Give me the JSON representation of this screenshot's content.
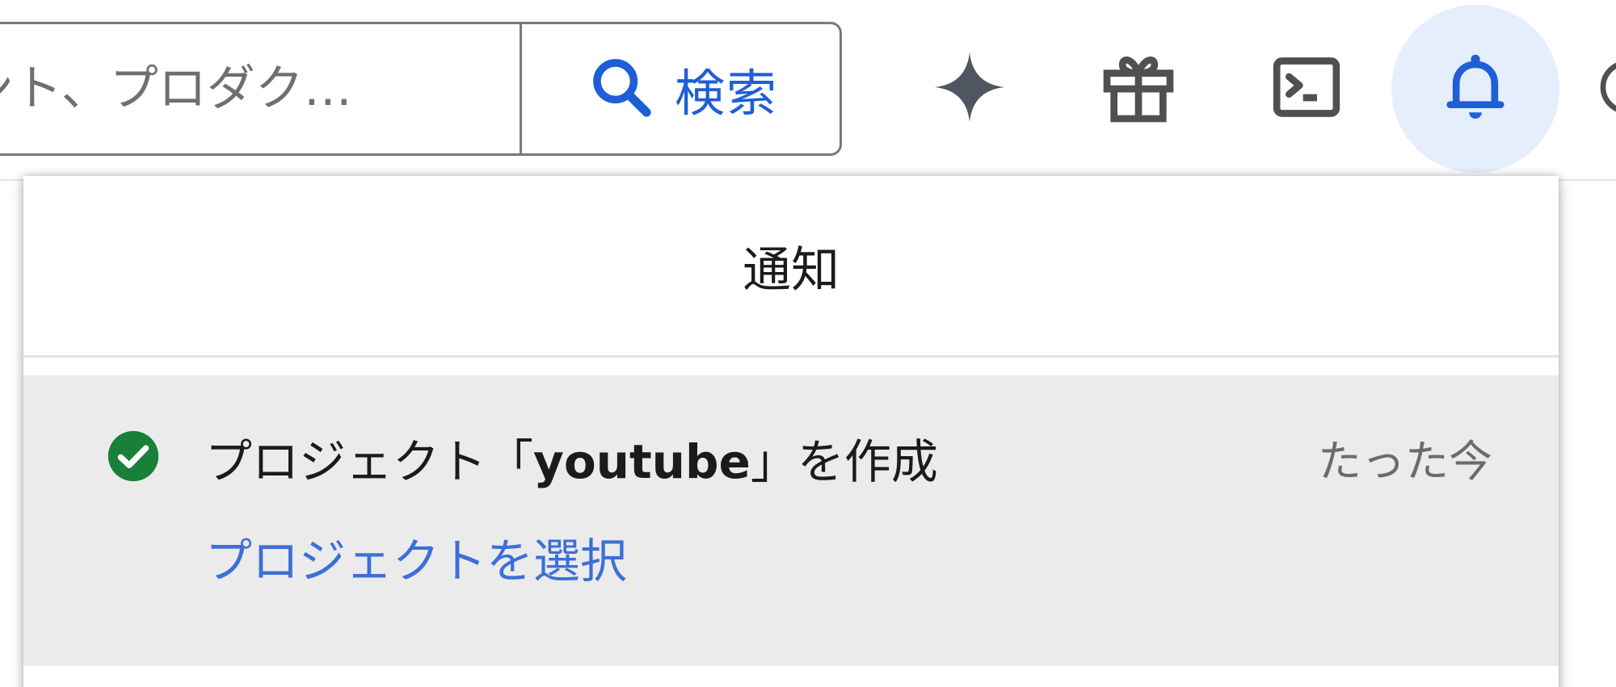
{
  "header": {
    "search": {
      "placeholder": "ント、プロダク…",
      "button_label": "検索"
    },
    "icons": [
      "sparkle-icon",
      "gift-icon",
      "terminal-icon",
      "bell-icon",
      "help-icon"
    ],
    "accent_color": "#1f5fd6",
    "bell_active_bg": "#e5eefc"
  },
  "notifications": {
    "title": "通知",
    "items": [
      {
        "status": "success",
        "status_color": "#188038",
        "message_prefix": "プロジェクト「",
        "message_project": "youtube",
        "message_suffix": "」を作成",
        "time": "たった今",
        "action_label": "プロジェクトを選択"
      }
    ]
  }
}
